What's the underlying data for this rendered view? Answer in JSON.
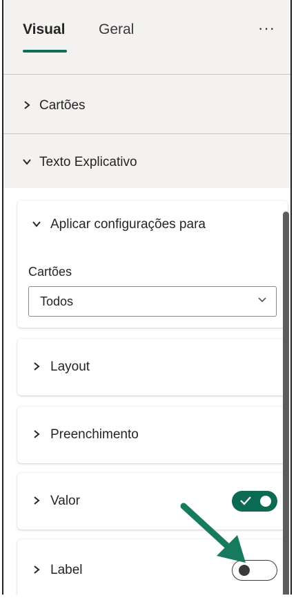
{
  "tabs": [
    {
      "label": "Visual",
      "active": true
    },
    {
      "label": "Geral",
      "active": false
    }
  ],
  "more_label": "···",
  "sections": {
    "cartoes": {
      "label": "Cartões",
      "expanded": false
    },
    "texto": {
      "label": "Texto Explicativo",
      "expanded": true
    }
  },
  "cards": {
    "aplicar": {
      "label": "Aplicar configurações para",
      "expanded": true,
      "field_label": "Cartões",
      "dropdown_value": "Todos"
    },
    "layout": {
      "label": "Layout"
    },
    "preenchimento": {
      "label": "Preenchimento"
    },
    "valor": {
      "label": "Valor",
      "toggle_on": true
    },
    "label": {
      "label": "Label",
      "toggle_on": false
    }
  },
  "colors": {
    "accent": "#0b6a52",
    "arrow": "#167a5f"
  },
  "icons": {
    "collapsed": "chevron-right-icon",
    "expanded": "chevron-down-icon"
  }
}
